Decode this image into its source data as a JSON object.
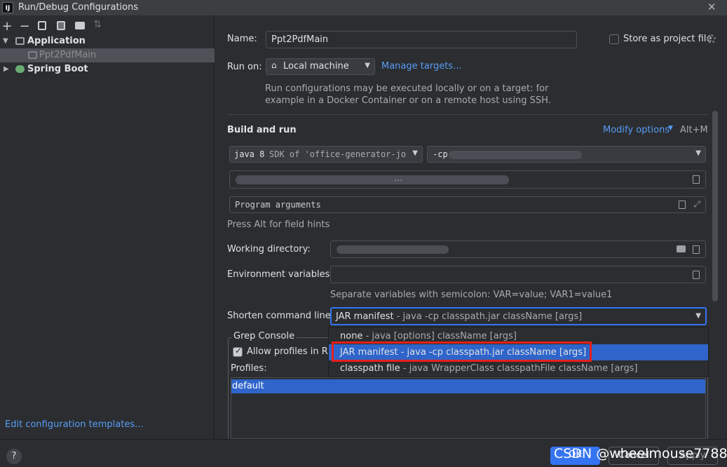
{
  "window": {
    "title": "Run/Debug Configurations",
    "logo": "IJ",
    "close_glyph": "✕"
  },
  "toolbar": {
    "add": "+",
    "remove": "−",
    "copy": "⧉",
    "save": "💾",
    "new_folder": "📁",
    "sort": "⇅"
  },
  "tree": {
    "items": [
      {
        "label": "Application",
        "expanded": true
      },
      {
        "label": "Ppt2PdfMain",
        "selected": true
      },
      {
        "label": "Spring Boot",
        "expanded": false
      }
    ],
    "edit_templates": "Edit configuration templates..."
  },
  "form": {
    "name_label": "Name:",
    "name_value": "Ppt2PdfMain",
    "store_label": "Store as project file",
    "run_on_label": "Run on:",
    "run_on_value": "Local machine",
    "manage_targets": "Manage targets...",
    "run_hint_1": "Run configurations may be executed locally or on a target: for",
    "run_hint_2": "example in a Docker Container or on a remote host using SSH.",
    "build_and_run": "Build and run",
    "modify_options": "Modify options",
    "modify_shortcut": "Alt+M",
    "sdk_java": "java 8",
    "sdk_rest": "SDK of 'office-generator-job",
    "classpath": "-cp",
    "main_class_dots": "...",
    "program_args_placeholder": "Program arguments",
    "alt_hint": "Press Alt for field hints",
    "working_dir_label": "Working directory:",
    "env_label": "Environment variables:",
    "env_hint": "Separate variables with semicolon: VAR=value; VAR1=value1",
    "shorten_label": "Shorten command line:",
    "shorten_value_main": "JAR manifest",
    "shorten_value_rest": " - java -cp classpath.jar className [args]"
  },
  "dropdown": {
    "options": [
      {
        "main": "none",
        "rest": " - java [options] className [args]"
      },
      {
        "main": "JAR manifest - java -cp classpath.jar className [args]",
        "rest": ""
      },
      {
        "main": "classpath file",
        "rest": " - java WrapperClass classpathFile className [args]"
      }
    ]
  },
  "grep": {
    "group_label": "Grep Console",
    "allow_profiles": "Allow profiles in Run",
    "profiles_label": "Profiles:",
    "profile_items": [
      "default"
    ]
  },
  "footer": {
    "help": "?",
    "ok": "OK",
    "cancel": "Cancel",
    "apply": "Apply",
    "watermark": "CSDN @wheelmouse7788"
  },
  "colors": {
    "accent": "#3574f0",
    "link": "#589df6",
    "selection": "#2f65ca",
    "highlight_box": "#e5201c"
  }
}
